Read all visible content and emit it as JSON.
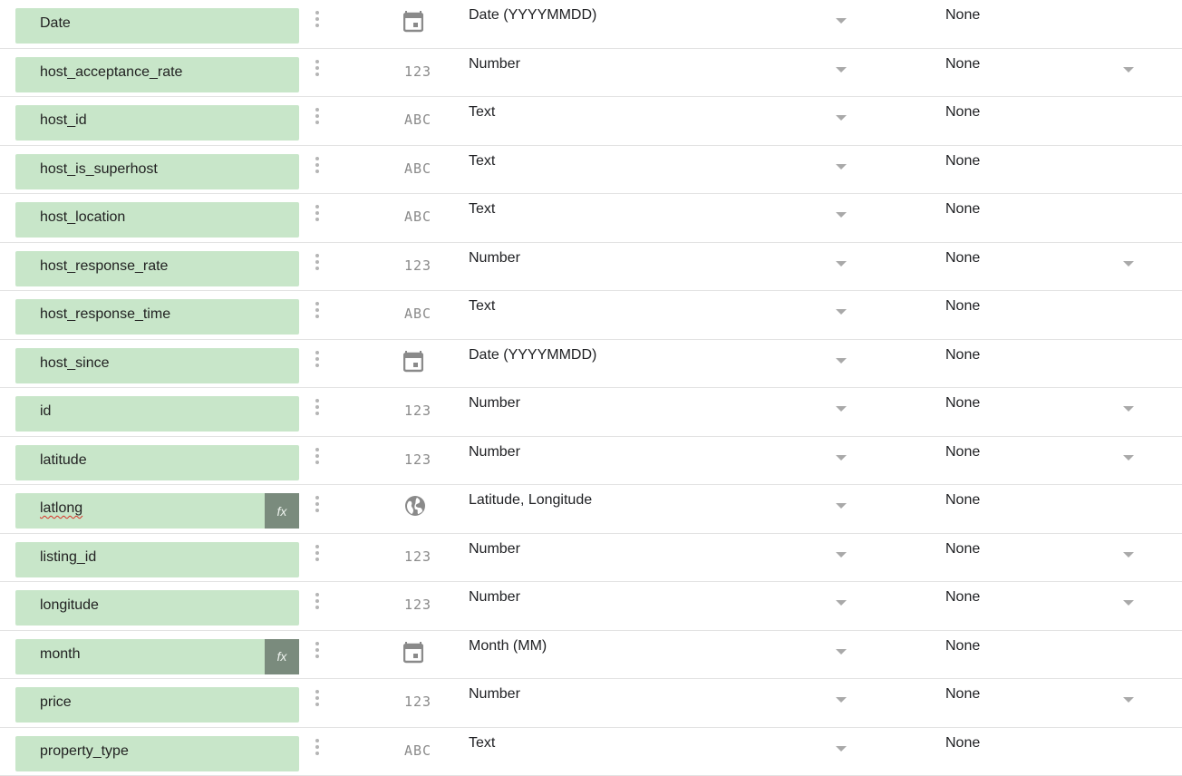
{
  "colors": {
    "chip": "#c8e6c9",
    "fx_badge": "#7a8b7d",
    "icon": "#8a8a8a"
  },
  "fields": [
    {
      "name": "Date",
      "calc": false,
      "icon": "calendar-icon",
      "type": "Date (YYYYMMDD)",
      "aggregation": "None",
      "agg_dropdown": false
    },
    {
      "name": "host_acceptance_rate",
      "calc": false,
      "icon": "number-icon",
      "glyph": "123",
      "type": "Number",
      "aggregation": "None",
      "agg_dropdown": true
    },
    {
      "name": "host_id",
      "calc": false,
      "icon": "text-icon",
      "glyph": "ABC",
      "type": "Text",
      "aggregation": "None",
      "agg_dropdown": false
    },
    {
      "name": "host_is_superhost",
      "calc": false,
      "icon": "text-icon",
      "glyph": "ABC",
      "type": "Text",
      "aggregation": "None",
      "agg_dropdown": false
    },
    {
      "name": "host_location",
      "calc": false,
      "icon": "text-icon",
      "glyph": "ABC",
      "type": "Text",
      "aggregation": "None",
      "agg_dropdown": false
    },
    {
      "name": "host_response_rate",
      "calc": false,
      "icon": "number-icon",
      "glyph": "123",
      "type": "Number",
      "aggregation": "None",
      "agg_dropdown": true
    },
    {
      "name": "host_response_time",
      "calc": false,
      "icon": "text-icon",
      "glyph": "ABC",
      "type": "Text",
      "aggregation": "None",
      "agg_dropdown": false
    },
    {
      "name": "host_since",
      "calc": false,
      "icon": "calendar-icon",
      "type": "Date (YYYYMMDD)",
      "aggregation": "None",
      "agg_dropdown": false
    },
    {
      "name": "id",
      "calc": false,
      "icon": "number-icon",
      "glyph": "123",
      "type": "Number",
      "aggregation": "None",
      "agg_dropdown": true
    },
    {
      "name": "latitude",
      "calc": false,
      "icon": "number-icon",
      "glyph": "123",
      "type": "Number",
      "aggregation": "None",
      "agg_dropdown": true
    },
    {
      "name": "latlong",
      "calc": true,
      "fx": "fx",
      "squiggle": true,
      "icon": "globe-icon",
      "type": "Latitude, Longitude",
      "aggregation": "None",
      "agg_dropdown": false
    },
    {
      "name": "listing_id",
      "calc": false,
      "icon": "number-icon",
      "glyph": "123",
      "type": "Number",
      "aggregation": "None",
      "agg_dropdown": true
    },
    {
      "name": "longitude",
      "calc": false,
      "icon": "number-icon",
      "glyph": "123",
      "type": "Number",
      "aggregation": "None",
      "agg_dropdown": true
    },
    {
      "name": "month",
      "calc": true,
      "fx": "fx",
      "icon": "calendar-icon",
      "type": "Month (MM)",
      "aggregation": "None",
      "agg_dropdown": false
    },
    {
      "name": "price",
      "calc": false,
      "icon": "number-icon",
      "glyph": "123",
      "type": "Number",
      "aggregation": "None",
      "agg_dropdown": true
    },
    {
      "name": "property_type",
      "calc": false,
      "icon": "text-icon",
      "glyph": "ABC",
      "type": "Text",
      "aggregation": "None",
      "agg_dropdown": false
    }
  ]
}
